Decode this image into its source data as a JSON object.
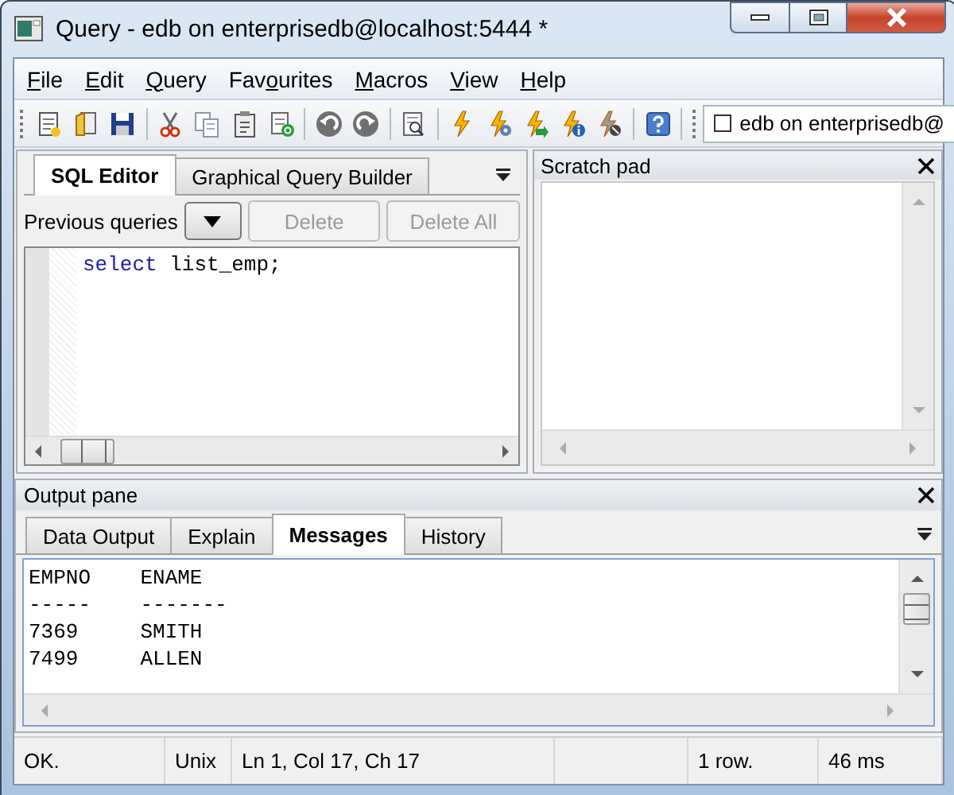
{
  "window": {
    "title": "Query - edb on enterprisedb@localhost:5444 *"
  },
  "menu": [
    {
      "parts": [
        {
          "text": "F",
          "underlined": true
        },
        {
          "text": "ile",
          "underlined": false
        }
      ]
    },
    {
      "parts": [
        {
          "text": "E",
          "underlined": true
        },
        {
          "text": "dit",
          "underlined": false
        }
      ]
    },
    {
      "parts": [
        {
          "text": "Q",
          "underlined": true
        },
        {
          "text": "uery",
          "underlined": false
        }
      ]
    },
    {
      "parts": [
        {
          "text": "Fav",
          "underlined": false
        },
        {
          "text": "o",
          "underlined": true
        },
        {
          "text": "urites",
          "underlined": false
        }
      ]
    },
    {
      "parts": [
        {
          "text": "M",
          "underlined": true
        },
        {
          "text": "acros",
          "underlined": false
        }
      ]
    },
    {
      "parts": [
        {
          "text": "V",
          "underlined": true
        },
        {
          "text": "iew",
          "underlined": false
        }
      ]
    },
    {
      "parts": [
        {
          "text": "H",
          "underlined": true
        },
        {
          "text": "elp",
          "underlined": false
        }
      ]
    }
  ],
  "toolbar": {
    "connection": {
      "label": "edb on enterprisedb@",
      "checked": false
    }
  },
  "sql_pane": {
    "tabs": [
      {
        "label": "SQL Editor",
        "selected": true
      },
      {
        "label": "Graphical Query Builder",
        "selected": false
      }
    ],
    "previous_queries": {
      "label": "Previous queries"
    },
    "buttons": [
      {
        "label": "Delete",
        "disabled": true
      },
      {
        "label": "Delete All",
        "disabled": true
      }
    ],
    "editor": {
      "lines": [
        [
          {
            "text": "select",
            "kind": "keyword"
          },
          {
            "text": " list_emp;",
            "kind": "plain"
          }
        ]
      ]
    }
  },
  "scratch_pad": {
    "title": "Scratch pad"
  },
  "output_pane": {
    "title": "Output pane",
    "tabs": [
      {
        "label": "Data Output",
        "selected": false
      },
      {
        "label": "Explain",
        "selected": false
      },
      {
        "label": "Messages",
        "selected": true
      },
      {
        "label": "History",
        "selected": false
      }
    ],
    "messages": [
      "EMPNO    ENAME",
      "-----    -------",
      "7369     SMITH",
      "7499     ALLEN"
    ]
  },
  "status_bar": {
    "fields": [
      "OK.",
      "Unix",
      "Ln 1, Col 17, Ch 17",
      "1 row.",
      "46 ms"
    ]
  }
}
